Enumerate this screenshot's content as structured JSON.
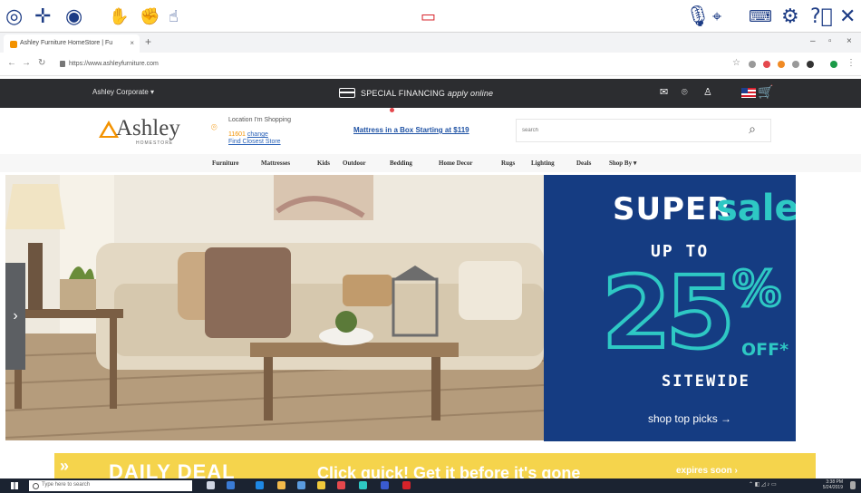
{
  "accessibility_toolbar": {
    "icons": [
      "settings-dial-icon",
      "move-cross-icon",
      "target-icon",
      "hand-swipe-icon",
      "hand-grab-icon",
      "hand-point-icon",
      "screen-touch-icon",
      "microphone-icon",
      "cursor-settings-icon",
      "keyboard-icon",
      "gear-icon",
      "help-icon",
      "close-icon"
    ],
    "accent": "#1d3c85"
  },
  "browser": {
    "tab_title": "Ashley Furniture HomeStore | Fu",
    "new_tab_glyph": "+",
    "url": "https://www.ashleyfurniture.com"
  },
  "site_top": {
    "corporate_label": "Ashley Corporate ▾",
    "financing_prefix": "SPECIAL FINANCING",
    "financing_suffix": "apply online"
  },
  "header": {
    "logo_text": "Ashley",
    "logo_sub": "HOMESTORE",
    "location_line": "Location I'm Shopping",
    "zip": "11601",
    "change_link": "change",
    "find_store_link": "Find Closest Store",
    "promo_link": "Mattress in a Box Starting at $119",
    "search_placeholder": "search"
  },
  "nav": {
    "items": [
      "Furniture",
      "Mattresses",
      "Kids",
      "Outdoor",
      "Bedding",
      "Home Decor",
      "Rugs",
      "Lighting",
      "Deals",
      "Shop By ▾"
    ]
  },
  "hero": {
    "prev_glyph": "›"
  },
  "sale": {
    "super": "SUPER",
    "sale": "sale",
    "up_to": "UP TO",
    "number": "25",
    "percent": "%",
    "off": "OFF*",
    "sitewide": "SITEWIDE",
    "cta": "shop top picks →",
    "colors": {
      "background": "#153c82",
      "accent": "#2ec8c4"
    }
  },
  "deal": {
    "title": "DAILY DEAL",
    "text": "Click quick! Get it before it's gone",
    "expires": "expires soon ›"
  },
  "taskbar": {
    "search_placeholder": "Type here to search",
    "time": "3:38 PM",
    "date": "5/24/2019"
  }
}
